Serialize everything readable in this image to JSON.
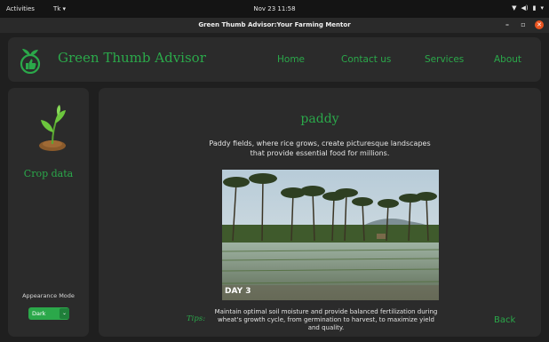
{
  "system_bar": {
    "activities": "Activities",
    "app_menu": "Tk ▾",
    "clock": "Nov 23  11:58",
    "network_icon": "▼",
    "volume_icon": "◀)",
    "battery_icon": "▮",
    "menu_arrow": "▾"
  },
  "window": {
    "title": "Green Thumb Advisor:Your Farming Mentor",
    "minimize": "–",
    "maximize": "▫",
    "close": "✕"
  },
  "navbar": {
    "brand": "Green Thumb Advisor",
    "links": [
      "Home",
      "Contact us",
      "Services",
      "About"
    ]
  },
  "sidebar": {
    "crop_data_label": "Crop data",
    "appearance_label": "Appearance Mode",
    "mode_value": "Dark",
    "mode_arrow": "⌄"
  },
  "main": {
    "crop_name": "paddy",
    "description": "Paddy fields, where rice grows, create picturesque landscapes that provide essential food for millions.",
    "photo_caption": "DAY 3",
    "tips_label": "Tips:",
    "tips_text": "Maintain optimal soil moisture and provide balanced fertilization during wheat's growth cycle, from germination to harvest, to maximize yield and quality.",
    "back_label": "Back"
  },
  "colors": {
    "accent": "#2ba84a",
    "background": "#1f1f1f",
    "panel": "#2b2b2b",
    "close_button": "#e95420"
  }
}
